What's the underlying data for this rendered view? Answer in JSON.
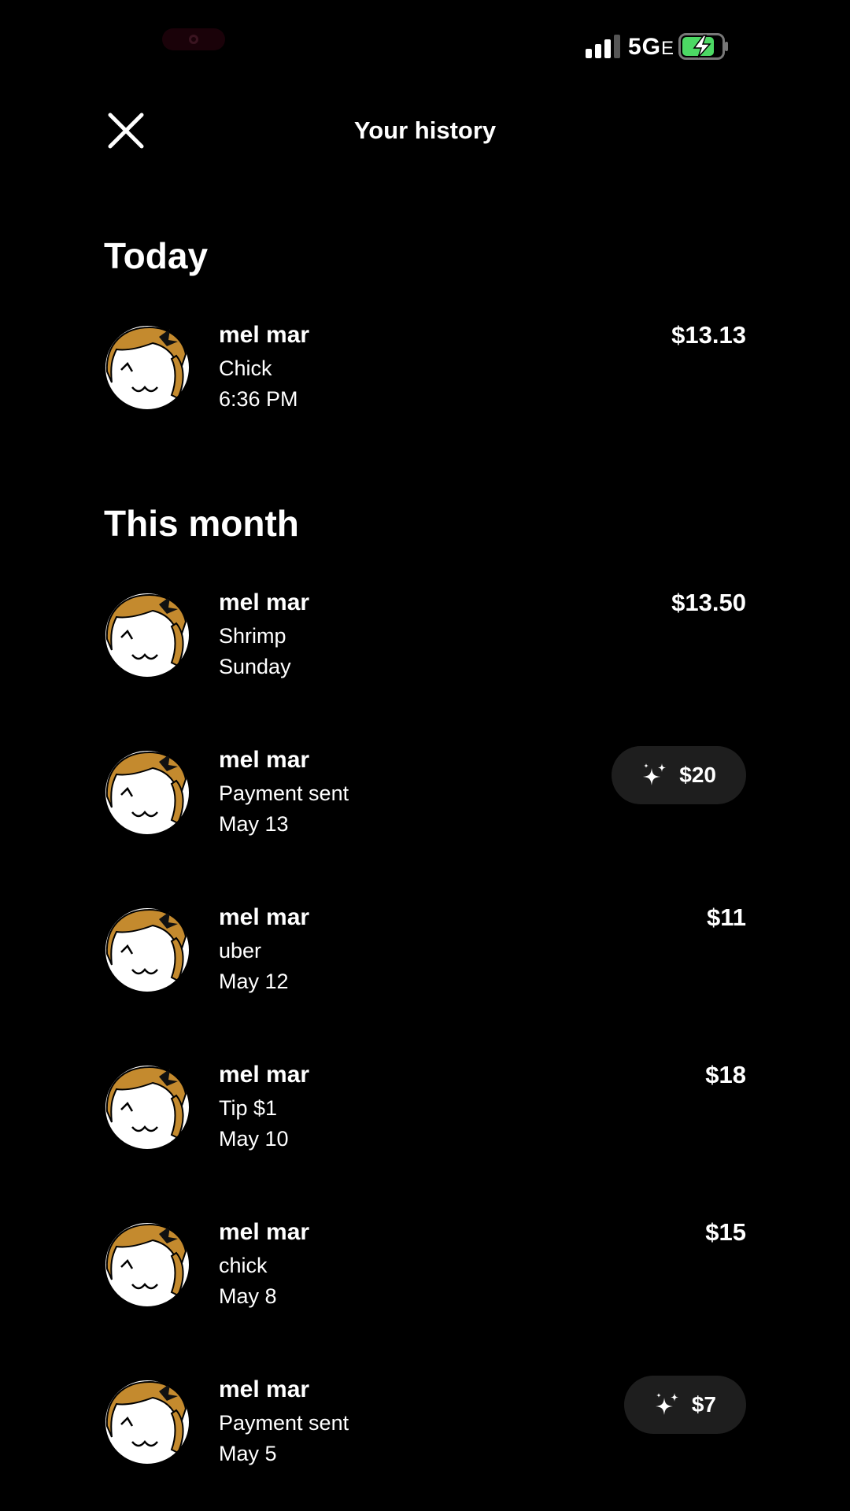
{
  "status_bar": {
    "network": "5G",
    "network_suffix": "E",
    "battery_color": "#4cd964"
  },
  "header": {
    "title": "Your history",
    "close_icon": "close-icon"
  },
  "sections": [
    {
      "heading": "Today",
      "items": [
        {
          "name": "mel mar",
          "memo": "Chick",
          "date": "6:36 PM",
          "amount": "$13.13",
          "boosted": false
        }
      ]
    },
    {
      "heading": "This month",
      "items": [
        {
          "name": "mel mar",
          "memo": "Shrimp",
          "date": "Sunday",
          "amount": "$13.50",
          "boosted": false
        },
        {
          "name": "mel mar",
          "memo": "Payment sent",
          "date": "May 13",
          "amount": "$20",
          "boosted": true
        },
        {
          "name": "mel mar",
          "memo": "uber",
          "date": "May 12",
          "amount": "$11",
          "boosted": false
        },
        {
          "name": "mel mar",
          "memo": "Tip $1",
          "date": "May 10",
          "amount": "$18",
          "boosted": false
        },
        {
          "name": "mel mar",
          "memo": "chick",
          "date": "May 8",
          "amount": "$15",
          "boosted": false
        },
        {
          "name": "mel mar",
          "memo": "Payment sent",
          "date": "May 5",
          "amount": "$7",
          "boosted": true
        }
      ]
    }
  ],
  "colors": {
    "background": "#000000",
    "text": "#ffffff",
    "pill_background": "#1e1e1e",
    "avatar_hair": "#c48a2e"
  }
}
